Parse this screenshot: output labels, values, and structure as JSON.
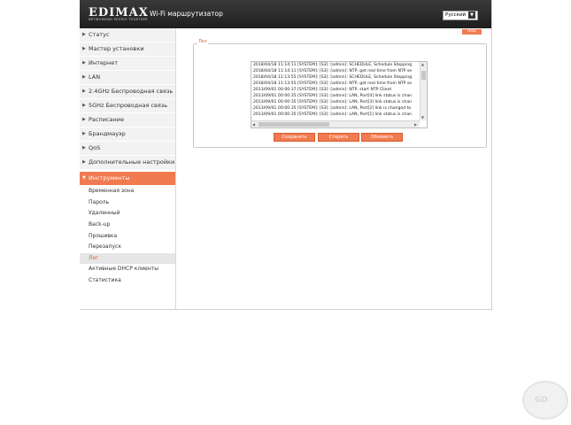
{
  "header": {
    "logo_text": "EDIMAX",
    "logo_tagline": "NETWORKING PEOPLE TOGETHER",
    "app_title": "Wi-Fi маршрутизатор",
    "language_selected": "Русский",
    "help_label": "Help"
  },
  "sidebar": {
    "items": [
      {
        "label": "Статус"
      },
      {
        "label": "Мастер установки"
      },
      {
        "label": "Интернет"
      },
      {
        "label": "LAN"
      },
      {
        "label": "2.4GHz Беспроводная связь"
      },
      {
        "label": "5GHz Беспроводная связь"
      },
      {
        "label": "Расписание"
      },
      {
        "label": "Брандмауэр"
      },
      {
        "label": "QoS"
      },
      {
        "label": "Дополнительные настройки"
      },
      {
        "label": "Инструменты"
      }
    ],
    "subitems": [
      {
        "label": "Временная зона"
      },
      {
        "label": "Пароль"
      },
      {
        "label": "Удаленный"
      },
      {
        "label": "Back-up"
      },
      {
        "label": "Прошивка"
      },
      {
        "label": "Перезапуск"
      },
      {
        "label": "Лог"
      },
      {
        "label": "Активные DHCP клиенты"
      },
      {
        "label": "Статистика"
      }
    ]
  },
  "main": {
    "section_title": "Лог",
    "log_lines": [
      "2018/04/18 11:14:11 [SYSTEM]: [S3]: [admin]: SCHEDULE, Schedule Stopping",
      "2018/04/18 11:14:11 [SYSTEM]: [S3]: [admin]: NTP, get real time from NTP se",
      "2018/04/18 11:13:55 [SYSTEM]: [S3]: [admin]: SCHEDULE, Schedule Stopping",
      "2018/04/18 11:13:55 [SYSTEM]: [S3]: [admin]: NTP, get real time from NTP se",
      "2013/09/01 00:00:37 [SYSTEM]: [S3]: [admin]: NTP, start NTP Client",
      "2013/09/01 00:00:35 [SYSTEM]: [S3]: [admin]: LAN, Port[4] link status is chan",
      "2013/09/01 00:00:35 [SYSTEM]: [S3]: [admin]: LAN, Port[3] link status is chan",
      "2013/09/01 00:00:35 [SYSTEM]: [S3]: [admin]: LAN, Port[2] link is changed to",
      "2013/09/01 00:00:35 [SYSTEM]: [S3]: [admin]: LAN, Port[1] link status is chan"
    ],
    "buttons": {
      "save": "Сохранить",
      "clear": "Стереть",
      "refresh": "Обновить"
    }
  },
  "colors": {
    "accent": "#f07b50",
    "header_bg": "#2b2b2b"
  }
}
